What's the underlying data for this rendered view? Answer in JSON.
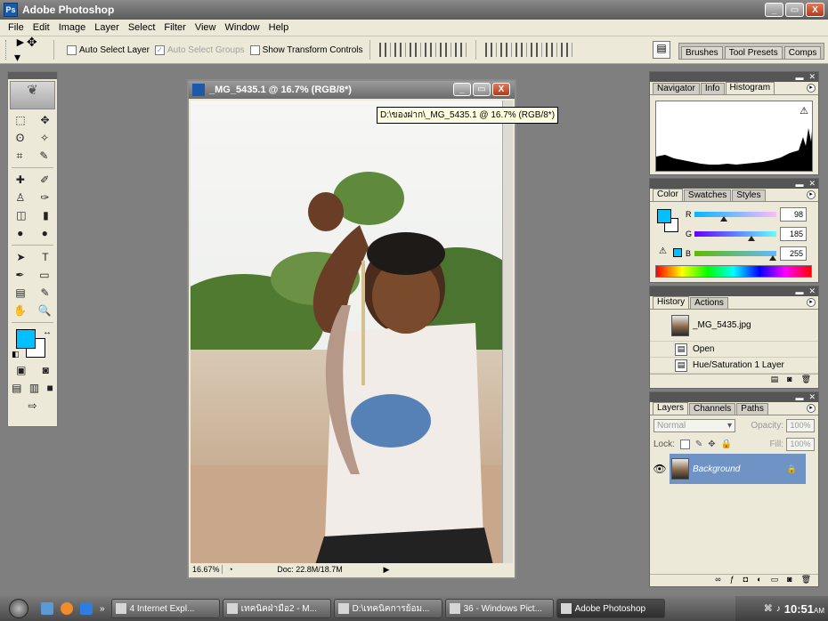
{
  "app": {
    "title": "Adobe Photoshop",
    "icon_label": "Ps",
    "window_buttons": {
      "minimize": "_",
      "maximize": "▭",
      "close": "X"
    }
  },
  "menu": {
    "items": [
      "File",
      "Edit",
      "Image",
      "Layer",
      "Select",
      "Filter",
      "View",
      "Window",
      "Help"
    ]
  },
  "options_bar": {
    "tool_glyph": "►✥ ▾",
    "auto_select_layer": {
      "label": "Auto Select Layer",
      "checked": false
    },
    "auto_select_groups": {
      "label": "Auto Select Groups",
      "checked": true,
      "disabled": true
    },
    "show_transform_controls": {
      "label": "Show Transform Controls",
      "checked": false
    },
    "align_buttons": 6,
    "distribute_buttons": 6,
    "well_glyph": "▤"
  },
  "palette_well": {
    "tabs": [
      "Brushes",
      "Tool Presets",
      "Comps"
    ]
  },
  "toolbox": {
    "rows": [
      [
        "⬚",
        "✥"
      ],
      [
        "ʘ",
        "✧"
      ],
      [
        "⌗",
        "✎"
      ],
      [
        "✚",
        "✐"
      ],
      [
        "♙",
        "✑"
      ],
      [
        "◫",
        "▮"
      ],
      [
        "●",
        "●"
      ],
      [
        "➤",
        "T"
      ],
      [
        "✒",
        "▭"
      ],
      [
        "▤",
        "✎"
      ],
      [
        "✋",
        "🔍"
      ]
    ],
    "foreground_color": "#00c0ff",
    "background_color": "#ffffff",
    "logo_glyph": "❦"
  },
  "document": {
    "title": "_MG_5435.1 @ 16.7% (RGB/8*)",
    "tooltip": "D:\\ของฝาก\\_MG_5435.1 @ 16.7% (RGB/8*)",
    "zoom": "16.67%",
    "doc_info": "Doc: 22.8M/18.7M",
    "window_buttons": {
      "minimize": "_",
      "maximize": "▭",
      "close": "X"
    }
  },
  "navigator_panel": {
    "tabs": [
      "Navigator",
      "Info",
      "Histogram"
    ],
    "active_tab": "Histogram",
    "warning_glyph": "⚠"
  },
  "color_panel": {
    "tabs": [
      "Color",
      "Swatches",
      "Styles"
    ],
    "active_tab": "Color",
    "foreground_color": "#00c0ff",
    "background_color": "#ffffff",
    "channels": [
      {
        "label": "R",
        "value": "98",
        "fraction": 0.38,
        "gradient": "linear-gradient(90deg,#00b9ff,#ffb9ff)"
      },
      {
        "label": "G",
        "value": "185",
        "fraction": 0.73,
        "gradient": "linear-gradient(90deg,#6200ff,#62ffff)"
      },
      {
        "label": "B",
        "value": "255",
        "fraction": 1.0,
        "gradient": "linear-gradient(90deg,#62b900,#62b9ff)"
      }
    ],
    "gamut_warning": "⚠"
  },
  "history_panel": {
    "tabs": [
      "History",
      "Actions"
    ],
    "active_tab": "History",
    "snapshot": "_MG_5435.jpg",
    "states": [
      "Open",
      "Hue/Saturation 1 Layer"
    ]
  },
  "layers_panel": {
    "tabs": [
      "Layers",
      "Channels",
      "Paths"
    ],
    "active_tab": "Layers",
    "blend_mode": "Normal",
    "opacity_label": "Opacity:",
    "opacity": "100%",
    "lock_label": "Lock:",
    "fill_label": "Fill:",
    "fill": "100%",
    "layers": [
      {
        "name": "Background",
        "visible": true,
        "locked": true
      }
    ]
  },
  "taskbar": {
    "buttons": [
      {
        "label": "4 Internet Expl...",
        "active": false
      },
      {
        "label": "เทคนิคฝ่ามือ2 - M...",
        "active": false
      },
      {
        "label": "D:\\เทคนิคการย้อม...",
        "active": false
      },
      {
        "label": "36 - Windows Pict...",
        "active": false
      },
      {
        "label": "Adobe Photoshop",
        "active": true
      }
    ],
    "quicklaunch_more": "»",
    "clock": "10:51",
    "clock_suffix": "AM"
  }
}
